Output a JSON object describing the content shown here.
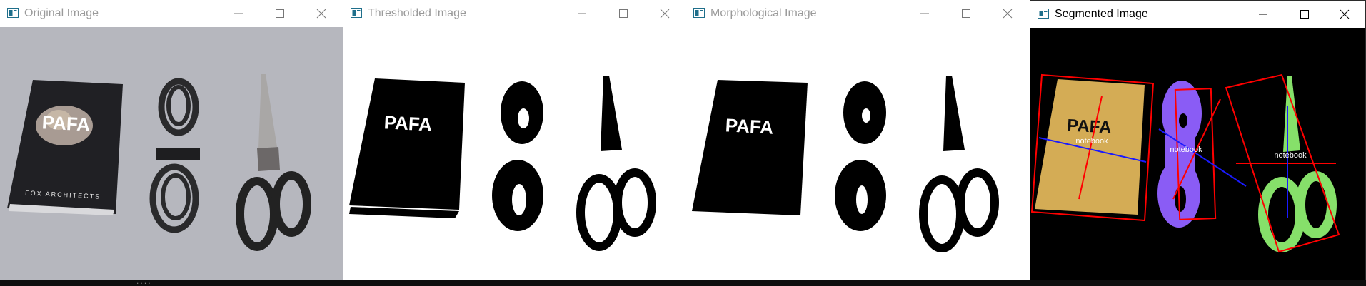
{
  "windows": [
    {
      "title": "Original Image"
    },
    {
      "title": "Thresholded Image"
    },
    {
      "title": "Morphological Image"
    },
    {
      "title": "Segmented Image"
    }
  ],
  "original": {
    "notebook_logo": "PAFA",
    "notebook_caption": "FOX ARCHITECTS"
  },
  "threshold": {
    "notebook_logo": "PAFA"
  },
  "morph": {
    "notebook_logo": "PAFA"
  },
  "segmented": {
    "notebook_logo": "PAFA",
    "labels": [
      "notebook",
      "notebook",
      "notebook"
    ]
  },
  "status": {
    "text": "...."
  },
  "colors": {
    "original_bg": "#b6b7be",
    "segment_notebook": "#d4ac55",
    "segment_cable": "#8a5cf5",
    "segment_scissors": "#86e06a",
    "bbox": "#ff0000",
    "axis": "#1a1aff"
  }
}
